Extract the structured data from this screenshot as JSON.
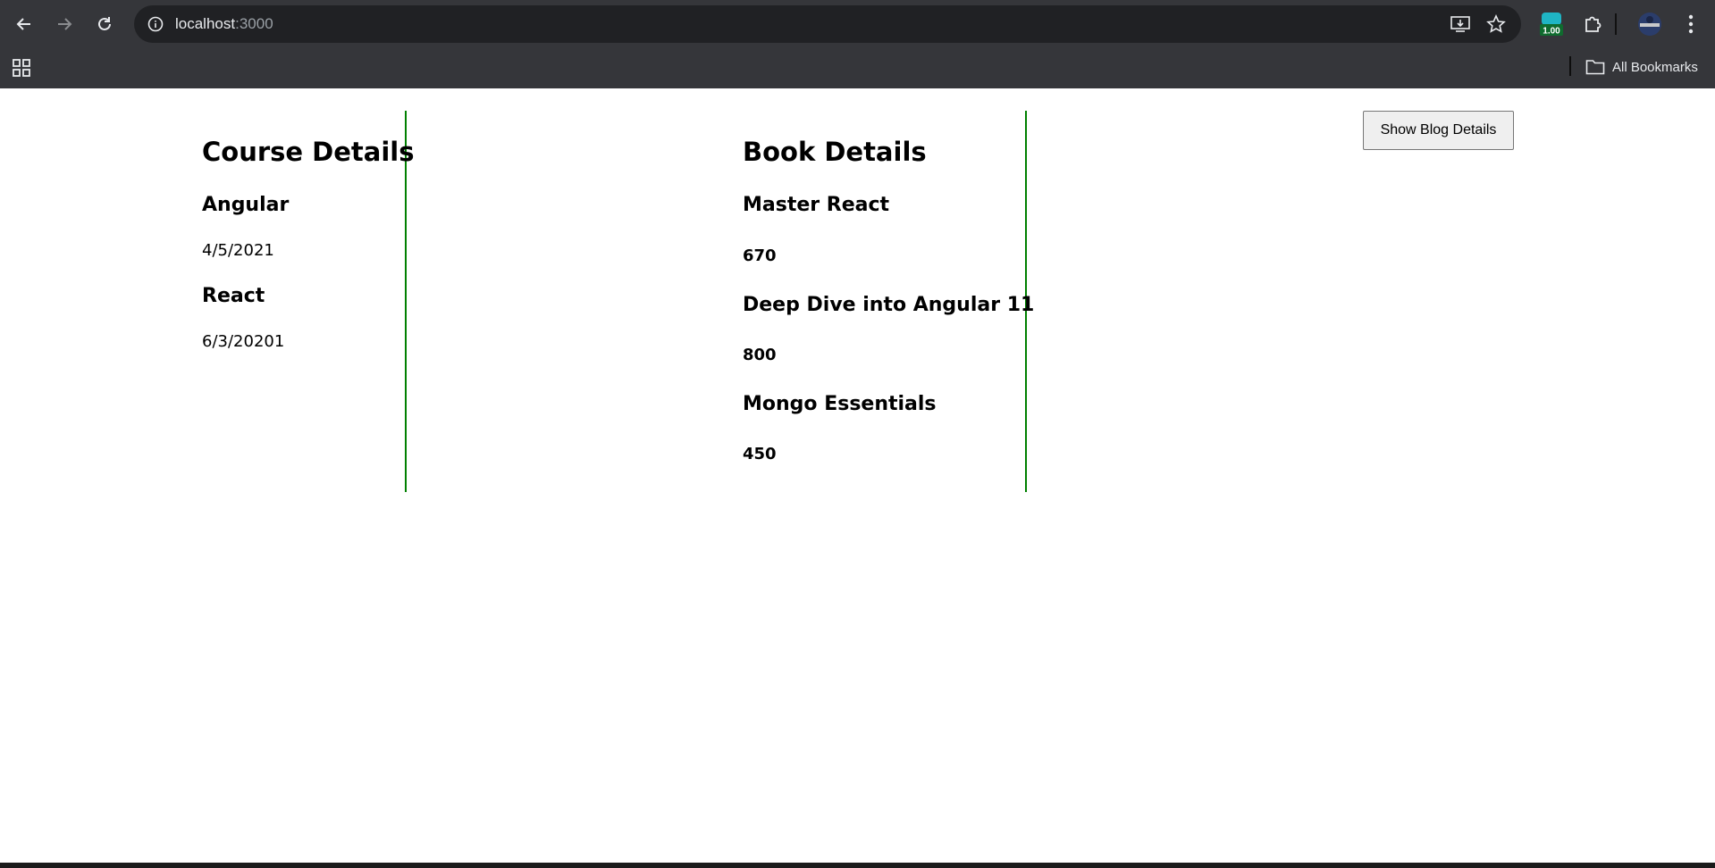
{
  "browser": {
    "url_host": "localhost",
    "url_port": ":3000",
    "extension_badge": "1.00",
    "bookmarks_label": "All Bookmarks"
  },
  "courses": {
    "title": "Course Details",
    "items": [
      {
        "name": "Angular",
        "date": "4/5/2021"
      },
      {
        "name": "React",
        "date": "6/3/20201"
      }
    ]
  },
  "books": {
    "title": "Book Details",
    "items": [
      {
        "name": "Master React",
        "price": "670"
      },
      {
        "name": "Deep Dive into Angular 11",
        "price": "800"
      },
      {
        "name": "Mongo Essentials",
        "price": "450"
      }
    ]
  },
  "actions": {
    "show_blog_label": "Show Blog Details"
  },
  "colors": {
    "divider": "#008000",
    "chrome_bg": "#35363a",
    "omnibox_bg": "#202124"
  }
}
